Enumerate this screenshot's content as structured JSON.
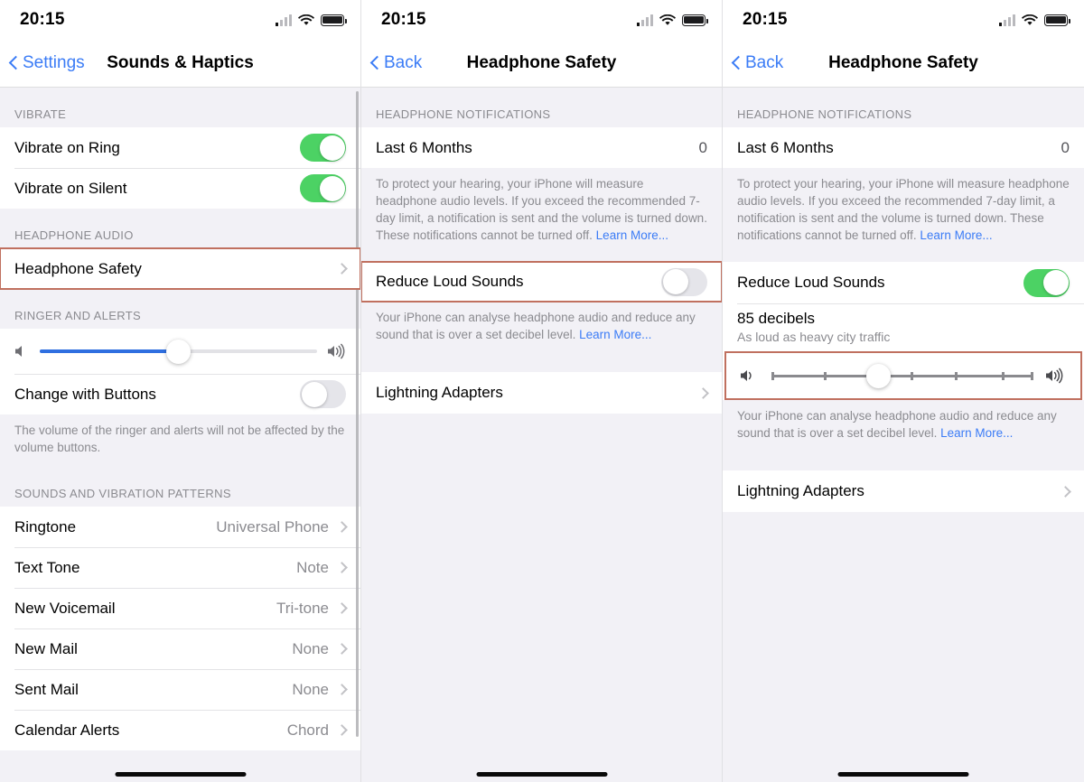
{
  "colors": {
    "accent_blue": "#3b7cf6",
    "toggle_on_green": "#4cd264",
    "highlight_red": "#c0705f",
    "slider_blue": "#2f6fe0",
    "grouped_background": "#f2f1f6"
  },
  "status_bar": {
    "time": "20:15",
    "signal_icon": "cellular-signal-icon",
    "wifi_icon": "wifi-icon",
    "battery_icon": "battery-icon"
  },
  "panels": [
    {
      "id": "sounds-and-haptics",
      "nav": {
        "back_label": "Settings",
        "title": "Sounds & Haptics"
      },
      "sections": [
        {
          "header": "VIBRATE",
          "rows": [
            {
              "label": "Vibrate on Ring",
              "type": "toggle",
              "on": true
            },
            {
              "label": "Vibrate on Silent",
              "type": "toggle",
              "on": true
            }
          ]
        },
        {
          "header": "HEADPHONE AUDIO",
          "rows": [
            {
              "label": "Headphone Safety",
              "type": "link",
              "highlight": true
            }
          ]
        },
        {
          "header": "RINGER AND ALERTS",
          "slider": {
            "value_percent": 50,
            "left_icon": "speaker-quiet-icon",
            "right_icon": "speaker-loud-icon"
          },
          "rows": [
            {
              "label": "Change with Buttons",
              "type": "toggle",
              "on": false
            }
          ],
          "footnote": "The volume of the ringer and alerts will not be affected by the volume buttons."
        },
        {
          "header": "SOUNDS AND VIBRATION PATTERNS",
          "rows": [
            {
              "label": "Ringtone",
              "value": "Universal Phone",
              "type": "link"
            },
            {
              "label": "Text Tone",
              "value": "Note",
              "type": "link"
            },
            {
              "label": "New Voicemail",
              "value": "Tri-tone",
              "type": "link"
            },
            {
              "label": "New Mail",
              "value": "None",
              "type": "link"
            },
            {
              "label": "Sent Mail",
              "value": "None",
              "type": "link"
            },
            {
              "label": "Calendar Alerts",
              "value": "Chord",
              "type": "link"
            }
          ]
        }
      ]
    },
    {
      "id": "headphone-safety-off",
      "nav": {
        "back_label": "Back",
        "title": "Headphone Safety"
      },
      "notifications": {
        "header": "HEADPHONE NOTIFICATIONS",
        "row_label": "Last 6 Months",
        "row_count": "0",
        "footnote_text": "To protect your hearing, your iPhone will measure headphone audio levels. If you exceed the recommended 7-day limit, a notification is sent and the volume is turned down. These notifications cannot be turned off. ",
        "footnote_link": "Learn More..."
      },
      "reduce": {
        "label": "Reduce Loud Sounds",
        "on": false,
        "highlight": true,
        "footnote_text": "Your iPhone can analyse headphone audio and reduce any sound that is over a set decibel level. ",
        "footnote_link": "Learn More..."
      },
      "adapters": {
        "label": "Lightning Adapters"
      }
    },
    {
      "id": "headphone-safety-on",
      "nav": {
        "back_label": "Back",
        "title": "Headphone Safety"
      },
      "notifications": {
        "header": "HEADPHONE NOTIFICATIONS",
        "row_label": "Last 6 Months",
        "row_count": "0",
        "footnote_text": "To protect your hearing, your iPhone will measure headphone audio levels. If you exceed the recommended 7-day limit, a notification is sent and the volume is turned down. These notifications cannot be turned off. ",
        "footnote_link": "Learn More..."
      },
      "reduce": {
        "label": "Reduce Loud Sounds",
        "on": true,
        "highlight": false,
        "decibel_title": "85 decibels",
        "decibel_subtitle": "As loud as heavy city traffic",
        "slider": {
          "value_percent": 41,
          "highlight": true,
          "ticks_percent": [
            0,
            20,
            41,
            53,
            70,
            88
          ],
          "left_icon": "speaker-quiet-icon",
          "right_icon": "speaker-loud-icon"
        },
        "footnote_text": "Your iPhone can analyse headphone audio and reduce any sound that is over a set decibel level. ",
        "footnote_link": "Learn More..."
      },
      "adapters": {
        "label": "Lightning Adapters"
      }
    }
  ]
}
